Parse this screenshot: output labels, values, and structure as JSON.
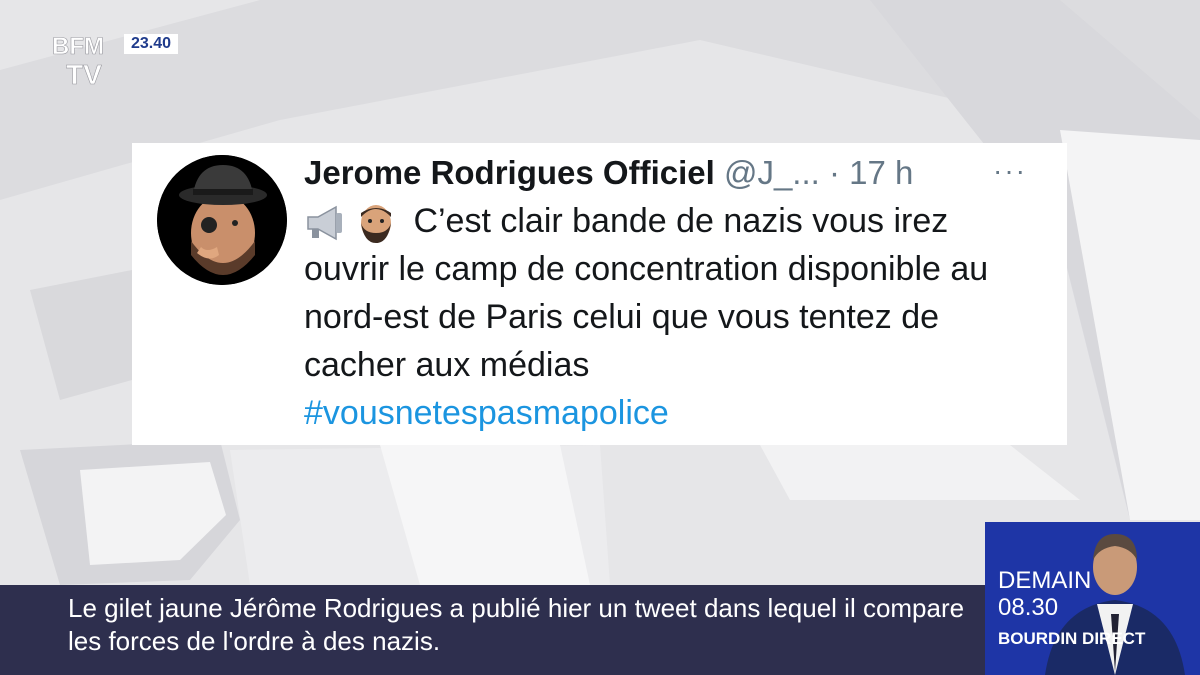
{
  "channel": {
    "logo_text_line1": "BFM",
    "logo_text_line2": "TV",
    "clock": "23.40",
    "brand_color": "#1e35a6"
  },
  "tweet": {
    "author": "Jerome Rodrigues Officiel",
    "handle": "@J_...",
    "time": "· 17 h",
    "more_label": "···",
    "emojis": [
      "megaphone-icon",
      "man-beard-icon"
    ],
    "body": "C’est clair bande de nazis vous irez ouvrir le camp de concentration disponible au nord-est de Paris celui que vous tentez de cacher aux médias",
    "hashtag": "#vousnetespasmapolice",
    "hashtag_color": "#1b95e0"
  },
  "lower_third": {
    "caption": "Le gilet jaune Jérôme Rodrigues a publié hier un tweet dans lequel il compare les forces de l'ordre à des nazis."
  },
  "promo": {
    "day": "DEMAIN",
    "time": "08.30",
    "show": "BOURDIN DIRECT"
  }
}
